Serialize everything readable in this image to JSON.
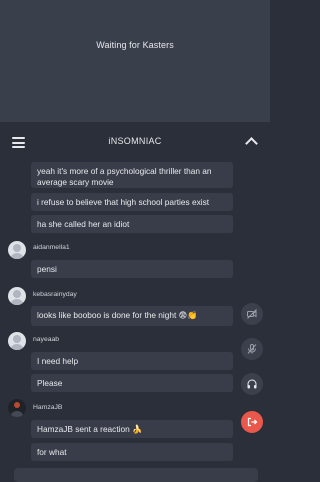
{
  "status": {
    "waiting_text": "Waiting for Kasters"
  },
  "chat_header": {
    "title": "iNSOMNIAC"
  },
  "messages": [
    {
      "text": "yeah it's more of a psychological thriller than an average scary movie"
    },
    {
      "text": "i refuse to believe that high school parties exist"
    },
    {
      "text": "ha she called her an idiot"
    },
    {
      "user": "aidanmella1",
      "text": "pensi"
    },
    {
      "user": "kebasrainyday",
      "text": "looks like booboo is done for the night 😨👏"
    },
    {
      "user": "nayeaab",
      "text": "I need help"
    },
    {
      "text": "Please"
    },
    {
      "user": "HamzaJB",
      "text": "HamzaJB sent a reaction 🍌"
    },
    {
      "text": "for what"
    }
  ],
  "icons": {
    "menu": "menu-icon",
    "collapse": "chevron-up-icon",
    "video_off": "video-off-icon",
    "mic_off": "mic-off-icon",
    "headphones": "headphones-icon",
    "leave": "leave-icon"
  },
  "colors": {
    "leave_button": "#e9584b",
    "panel_bg": "#2b2f39",
    "bubble_bg": "#383d49"
  }
}
